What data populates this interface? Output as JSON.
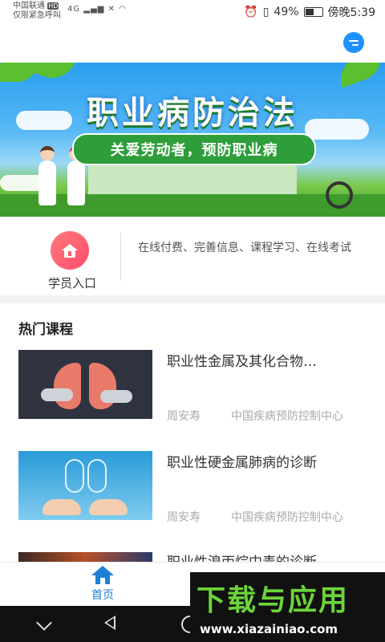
{
  "status_bar": {
    "carrier": "中国联通",
    "carrier_badge": "HD",
    "emergency": "仅限紧急呼叫",
    "network": "4G",
    "battery": "49%",
    "time": "傍晚5:39"
  },
  "banner": {
    "title": "职业病防治法",
    "subtitle": "关爱劳动者，预防职业病"
  },
  "entry": {
    "label": "学员入口",
    "description": "在线付费、完善信息、课程学习、在线考试",
    "icon": "home-plus-icon",
    "icon_color": "#ff5a73"
  },
  "section": {
    "title": "热门课程"
  },
  "courses": [
    {
      "title": "职业性金属及其化合物…",
      "author": "周安寿",
      "org": "中国疾病预防控制中心"
    },
    {
      "title": "职业性硬金属肺病的诊断",
      "author": "周安寿",
      "org": "中国疾病预防控制中心"
    },
    {
      "title": "职业性溴丙烷中毒的诊断",
      "author": "",
      "org": ""
    }
  ],
  "tabbar": {
    "home_label": "首页",
    "accent": "#1e7fd8"
  },
  "watermark": {
    "logo": "下载与应用",
    "url": "www.xiazainiao.com"
  }
}
